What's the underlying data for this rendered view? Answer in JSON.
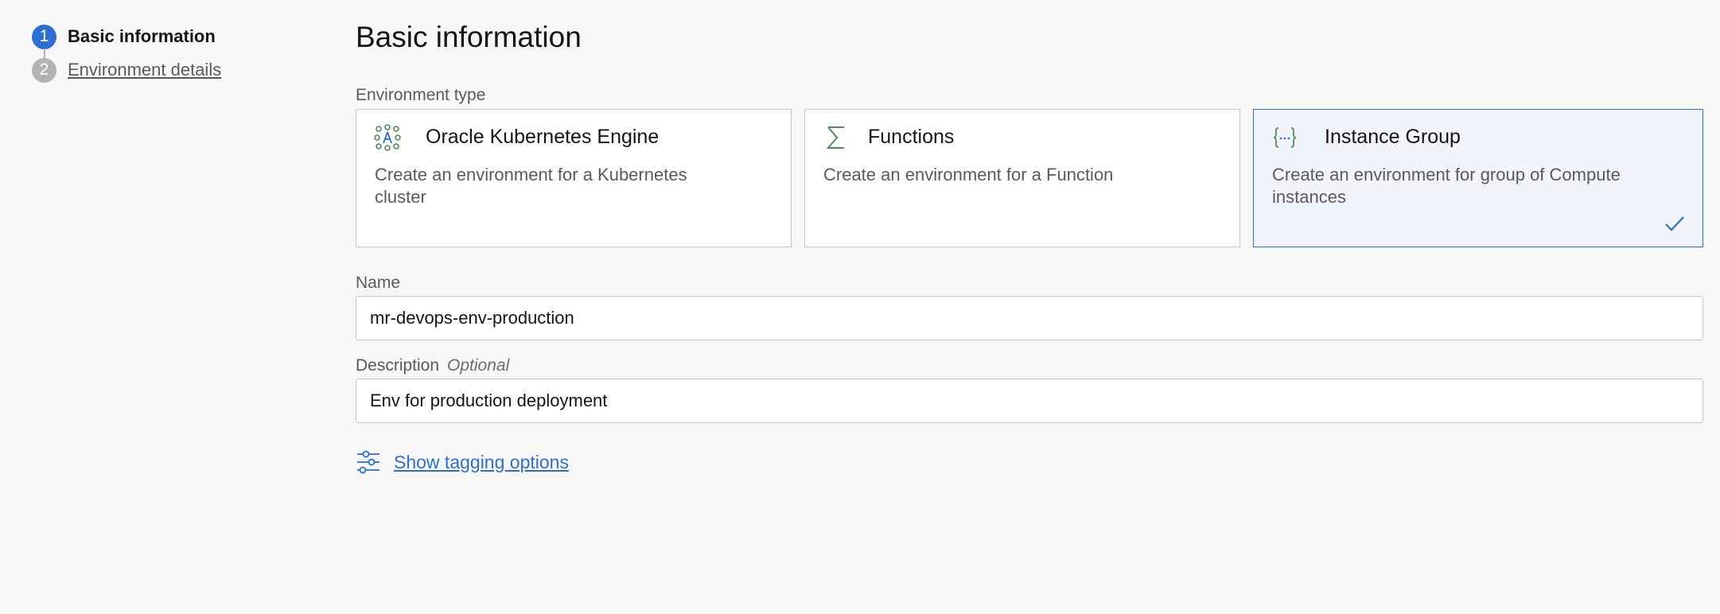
{
  "stepper": {
    "steps": [
      {
        "number": "1",
        "label": "Basic information",
        "state": "active"
      },
      {
        "number": "2",
        "label": "Environment details",
        "state": "inactive"
      }
    ]
  },
  "page": {
    "title": "Basic information"
  },
  "environment_type": {
    "label": "Environment type",
    "selected": "Instance Group",
    "options": [
      {
        "title": "Oracle Kubernetes Engine",
        "description": "Create an environment for a Kubernetes cluster",
        "icon": "kubernetes-icon"
      },
      {
        "title": "Functions",
        "description": "Create an environment for a Function",
        "icon": "sigma-icon"
      },
      {
        "title": "Instance Group",
        "description": "Create an environment for group of Compute instances",
        "icon": "curly-braces-icon"
      }
    ]
  },
  "name_field": {
    "label": "Name",
    "value": "mr-devops-env-production"
  },
  "description_field": {
    "label": "Description",
    "optional_label": "Optional",
    "value": "Env for production deployment"
  },
  "tagging": {
    "link_label": "Show tagging options",
    "icon": "sliders-icon"
  },
  "colors": {
    "accent": "#2d6fd1",
    "icon_green": "#4f8a5b",
    "background": "#f7f7f7",
    "selected_card_bg": "#f1f5fb"
  }
}
